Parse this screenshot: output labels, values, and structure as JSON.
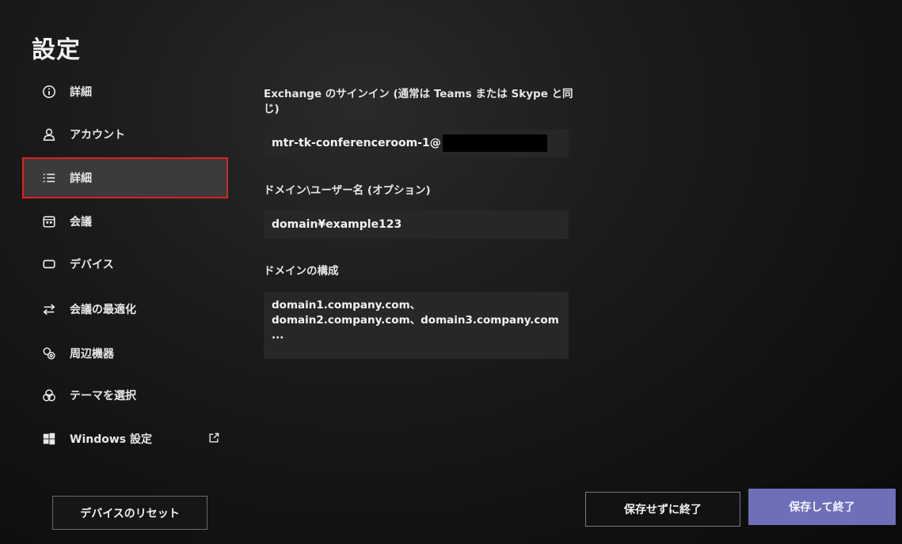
{
  "title": "設定",
  "nav": {
    "items": [
      {
        "label": "詳細",
        "icon": "info-icon"
      },
      {
        "label": "アカウント",
        "icon": "person-icon"
      },
      {
        "label": "詳細",
        "icon": "list-icon",
        "selected": true
      },
      {
        "label": "会議",
        "icon": "calendar-icon"
      },
      {
        "label": "デバイス",
        "icon": "device-icon"
      },
      {
        "label": "会議の最適化",
        "icon": "switch-arrows-icon"
      },
      {
        "label": "周辺機器",
        "icon": "peripherals-icon"
      },
      {
        "label": "テーマを選択",
        "icon": "theme-icon"
      },
      {
        "label": "Windows 設定",
        "icon": "windows-icon",
        "external": "external-link-icon"
      }
    ]
  },
  "form": {
    "exchange_label": "Exchange のサインイン (通常は Teams または Skype と同じ)",
    "exchange_value": "mtr-tk-conferenceroom-1@",
    "domain_user_label": "ドメイン\\ユーザー名 (オプション)",
    "domain_user_value": "domain¥example123",
    "domain_config_label": "ドメインの構成",
    "domain_config_value": "domain1.company.com、domain2.company.com、domain3.company.com ..."
  },
  "buttons": {
    "reset": "デバイスのリセット",
    "exit_without_save": "保存せずに終了",
    "save_and_exit": "保存して終了"
  },
  "colors": {
    "selection_outline": "#e61e1e",
    "primary_button": "#6e6fb8"
  }
}
